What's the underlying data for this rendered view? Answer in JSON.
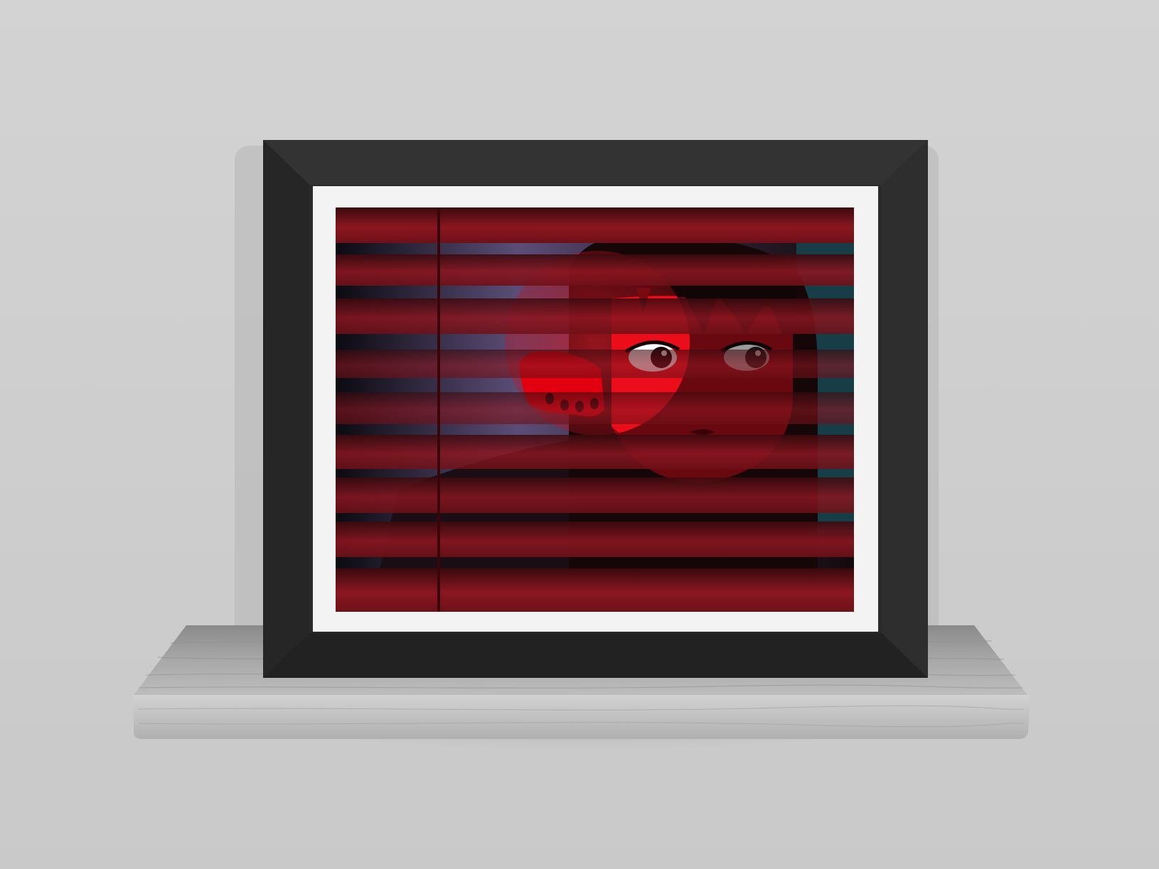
{
  "scene": {
    "description_free": true,
    "colors": {
      "wall": "#cfcfcf",
      "wall_shadow": "#b9b9b9",
      "shelf_top": "#9e9e9e",
      "shelf_front": "#c4c4c4",
      "frame_outer": "#2c2c2c",
      "frame_bevel_light": "#3a3a3a",
      "frame_bevel_dark": "#222222",
      "mat": "#f2f2f2",
      "blind_dark": "#5a0c16",
      "blind_light": "#8e1822",
      "slat_gap": "#0a0a0a",
      "room_glow": "#6a5a86",
      "skin_red": "#ec0011",
      "skin_dark": "#7a0a12",
      "hair": "#120607",
      "teal": "#1d4a52"
    },
    "icons": [
      "framed-print",
      "window-blinds",
      "wall-shelf"
    ]
  }
}
